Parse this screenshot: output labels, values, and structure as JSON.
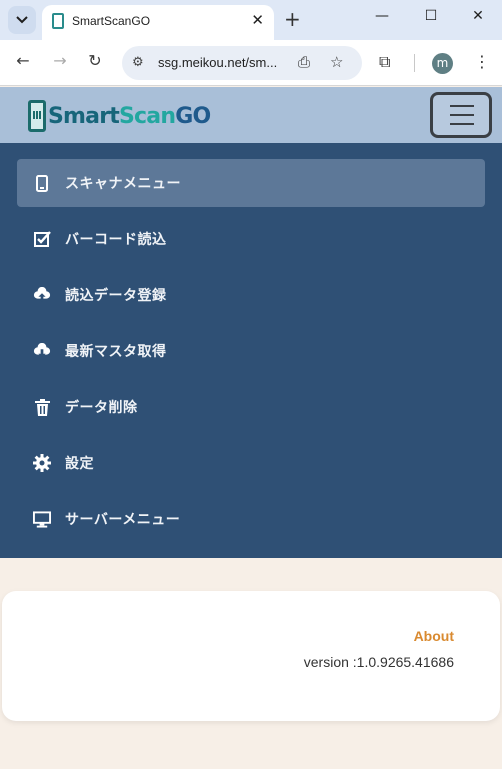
{
  "browser": {
    "tab_title": "SmartScanGO",
    "url": "ssg.meikou.net/sm...",
    "profile_initial": "m"
  },
  "app": {
    "logo_text": "SmartScanGO"
  },
  "nav": {
    "items": [
      {
        "label": "スキャナメニュー",
        "icon": "phone-icon",
        "active": true
      },
      {
        "label": "バーコード読込",
        "icon": "checkbox-icon",
        "active": false
      },
      {
        "label": "読込データ登録",
        "icon": "cloud-upload-icon",
        "active": false
      },
      {
        "label": "最新マスタ取得",
        "icon": "cloud-download-icon",
        "active": false
      },
      {
        "label": "データ削除",
        "icon": "trash-icon",
        "active": false
      },
      {
        "label": "設定",
        "icon": "gear-icon",
        "active": false
      },
      {
        "label": "サーバーメニュー",
        "icon": "monitor-icon",
        "active": false
      }
    ]
  },
  "content": {
    "about_label": "About",
    "version_text": "version :1.0.9265.41686"
  },
  "colors": {
    "header_bg": "#a9bfd8",
    "nav_bg": "#2f5075",
    "nav_active_bg": "#5d7898",
    "about_color": "#d98a30",
    "page_bg": "#f7efe7"
  }
}
